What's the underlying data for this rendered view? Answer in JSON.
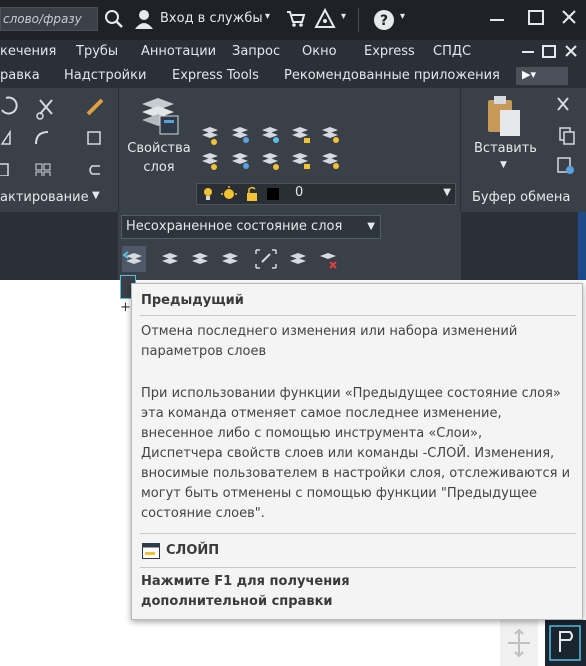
{
  "title_bar": {
    "search_placeholder": "слово/фразу",
    "signin_label": "Вход в службы",
    "colors": {
      "background": "#1e2126",
      "text": "#e6e8eb"
    }
  },
  "menu_bar": {
    "items": [
      "кечения",
      "Трубы",
      "Аннотации",
      "Запрос",
      "Окно",
      "Express",
      "СПДС"
    ]
  },
  "ribbon_tabs": {
    "items": [
      "равка",
      "Надстройки",
      "Express Tools",
      "Рекомендованные приложения"
    ]
  },
  "ribbon": {
    "modify_panel_label": "актирование",
    "layer_properties_label": "Свойства\nслоя",
    "layer_properties_line1": "Свойства",
    "layer_properties_line2": "слоя",
    "layer_combo_value": "0",
    "layer_state_value": "Несохраненное состояние слоя",
    "paste_label": "Вставить",
    "clipboard_panel_label": "Буфер обмена"
  },
  "tooltip": {
    "title": "Предыдущий",
    "summary_line1": "Отмена последнего изменения или набора изменений",
    "summary_line2": "параметров слоев",
    "desc_lines": [
      "При использовании функции «Предыдущее состояние слоя»",
      "эта команда отменяет самое последнее изменение,",
      "внесенное либо с помощью инструмента «Слои»,",
      "Диспетчера свойств слоев или команды -СЛОЙ. Изменения,",
      "вносимые пользователем в настройки слоя, отслеживаются и",
      "могут быть отменены с помощью функции \"Предыдущее",
      "состояние слоев\"."
    ],
    "command_name": "СЛОЙП",
    "help_line1": "Нажмите F1 для получения",
    "help_line2": "дополнительной справки"
  }
}
